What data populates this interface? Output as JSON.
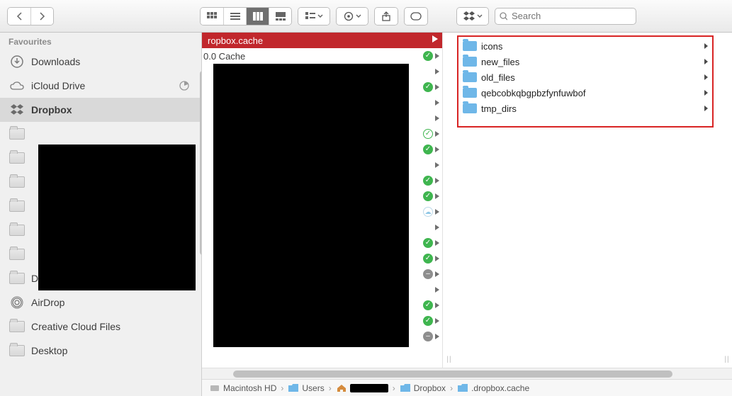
{
  "toolbar": {
    "search_placeholder": "Search"
  },
  "sidebar": {
    "section": "Favourites",
    "items": [
      {
        "label": "Downloads",
        "icon": "download"
      },
      {
        "label": "iCloud Drive",
        "icon": "cloud",
        "trail": "pie"
      },
      {
        "label": "Dropbox",
        "icon": "dropbox",
        "selected": true
      },
      {
        "label": "",
        "icon": "folder"
      },
      {
        "label": "",
        "icon": "folder"
      },
      {
        "label": "",
        "icon": "folder"
      },
      {
        "label": "",
        "icon": "folder"
      },
      {
        "label": "",
        "icon": "folder"
      },
      {
        "label": "",
        "icon": "folder"
      },
      {
        "label": "Documents",
        "icon": "folder"
      },
      {
        "label": "AirDrop",
        "icon": "airdrop"
      },
      {
        "label": "Creative Cloud Files",
        "icon": "folder"
      },
      {
        "label": "Desktop",
        "icon": "folder"
      }
    ]
  },
  "col1": {
    "header": "ropbox.cache",
    "row1": "0.0 Cache",
    "statuses": [
      "green",
      "clear",
      "green",
      "clear",
      "clear",
      "outline",
      "green",
      "clear",
      "green",
      "green",
      "cloud",
      "clear",
      "green",
      "green",
      "grey",
      "clear",
      "green",
      "green",
      "grey"
    ]
  },
  "col2": {
    "items": [
      "icons",
      "new_files",
      "old_files",
      "qebcobkqbgpbzfynfuwbof",
      "tmp_dirs"
    ]
  },
  "path": {
    "segments": [
      {
        "label": "Macintosh HD",
        "icon": "disk"
      },
      {
        "label": "Users",
        "icon": "bluefolder"
      },
      {
        "label": "",
        "icon": "home",
        "redacted": true
      },
      {
        "label": "Dropbox",
        "icon": "bluefolder"
      },
      {
        "label": ".dropbox.cache",
        "icon": "bluefolder"
      }
    ]
  }
}
